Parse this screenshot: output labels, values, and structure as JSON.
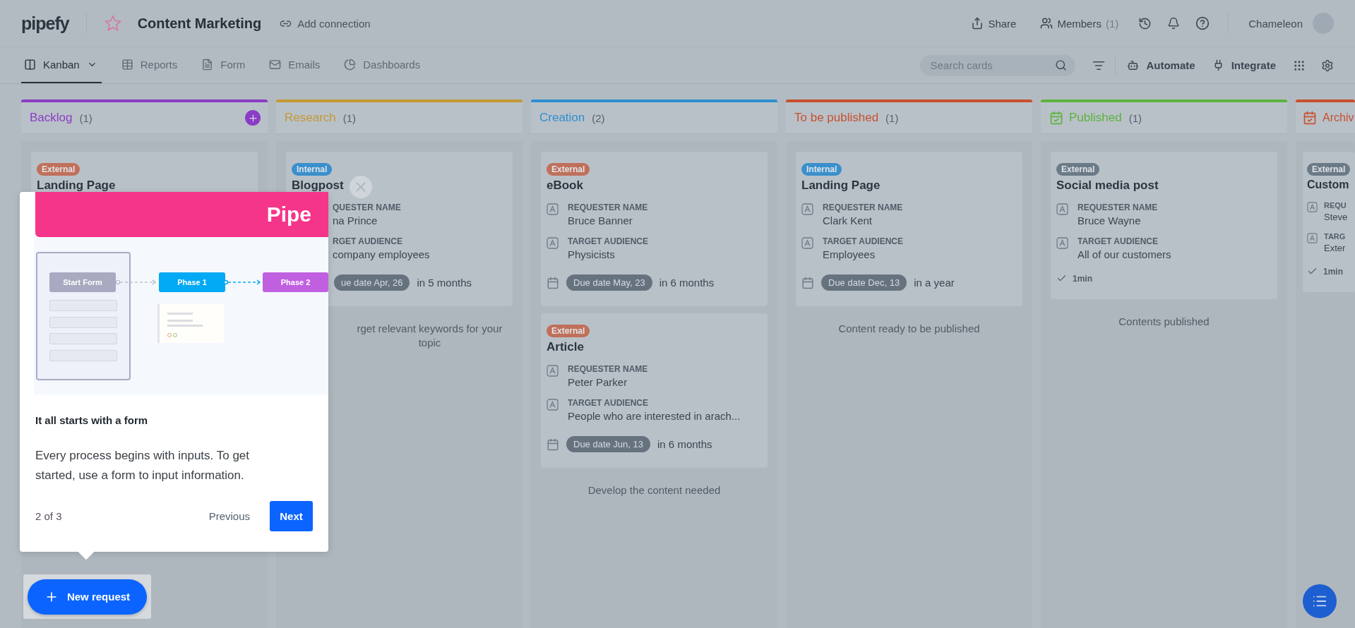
{
  "header": {
    "logo": "pipefy",
    "title": "Content Marketing",
    "add_connection": "Add connection",
    "share": "Share",
    "members": {
      "label": "Members",
      "count": "(1)"
    },
    "user": "Chameleon"
  },
  "nav": {
    "tabs": [
      {
        "label": "Kanban",
        "kind": "kanban",
        "selected": true
      },
      {
        "label": "Reports",
        "kind": "reports",
        "selected": false
      },
      {
        "label": "Form",
        "kind": "form",
        "selected": false
      },
      {
        "label": "Emails",
        "kind": "emails",
        "selected": false
      },
      {
        "label": "Dashboards",
        "kind": "dashboards",
        "selected": false
      }
    ],
    "search": {
      "placeholder": "Search cards"
    },
    "tools": [
      {
        "label": "Automate",
        "kind": "robot"
      },
      {
        "label": "Integrate",
        "kind": "plug"
      }
    ]
  },
  "columns": [
    {
      "title": "Backlog",
      "count": "(1)",
      "color": "#8a3dc4",
      "kind": "open",
      "add_button": true,
      "cards": [
        {
          "tag": {
            "label": "External",
            "color": "#c0705a"
          },
          "title": "Landing Page",
          "covered": true
        }
      ]
    },
    {
      "title": "Research",
      "count": "(1)",
      "color": "#c39a34",
      "kind": "open",
      "add_button": false,
      "cards": [
        {
          "tag": {
            "label": "Internal",
            "color": "#3a8fcc"
          },
          "title": "Blogpost",
          "covered": true,
          "fields": [
            {
              "label": "QUESTER NAME",
              "value": "na Prince"
            },
            {
              "label": "RGET AUDIENCE",
              "value": "company employees"
            }
          ],
          "due": {
            "label": "ue date Apr, 26",
            "relative": "in 5 months"
          }
        }
      ],
      "footer": [
        "rget relevant keywords for your",
        "topic"
      ],
      "footer_covered": true
    },
    {
      "title": "Creation",
      "count": "(2)",
      "color": "#2d8fd0",
      "kind": "open",
      "add_button": false,
      "cards": [
        {
          "tag": {
            "label": "External",
            "color": "#c0705a"
          },
          "title": "eBook",
          "covered": false,
          "fields": [
            {
              "label": "REQUESTER NAME",
              "value": "Bruce Banner"
            },
            {
              "label": "TARGET AUDIENCE",
              "value": "Physicists"
            }
          ],
          "due": {
            "label": "Due date May, 23",
            "relative": "in 6 months"
          }
        },
        {
          "tag": {
            "label": "External",
            "color": "#c0705a"
          },
          "title": "Article",
          "covered": false,
          "fields": [
            {
              "label": "REQUESTER NAME",
              "value": "Peter Parker"
            },
            {
              "label": "TARGET AUDIENCE",
              "value": "People who are interested in arach..."
            }
          ],
          "due": {
            "label": "Due date Jun, 13",
            "relative": "in 6 months"
          }
        }
      ],
      "footer": [
        "Develop the content needed"
      ]
    },
    {
      "title": "To be published",
      "count": "(1)",
      "color": "#c7512f",
      "kind": "open",
      "add_button": false,
      "cards": [
        {
          "tag": {
            "label": "Internal",
            "color": "#3a8fcc"
          },
          "title": "Landing Page",
          "covered": false,
          "fields": [
            {
              "label": "REQUESTER NAME",
              "value": "Clark Kent"
            },
            {
              "label": "TARGET AUDIENCE",
              "value": "Employees"
            }
          ],
          "due": {
            "label": "Due date Dec, 13",
            "relative": "in a year"
          }
        }
      ],
      "footer": [
        "Content ready to be published"
      ]
    },
    {
      "title": "Published",
      "count": "(1)",
      "color": "#5cb43e",
      "kind": "done",
      "add_button": false,
      "cards": [
        {
          "tag": {
            "label": "External",
            "color": "#6b7a87"
          },
          "title": "Social media post",
          "covered": false,
          "fields": [
            {
              "label": "REQUESTER NAME",
              "value": "Bruce Wayne"
            },
            {
              "label": "TARGET AUDIENCE",
              "value": "All of our customers"
            }
          ],
          "completed": "1min"
        }
      ],
      "footer": [
        "Contents published"
      ]
    },
    {
      "title": "Archiv",
      "color": "#c7512f",
      "kind": "done",
      "add_button": false,
      "cut": true,
      "cards": [
        {
          "tag": {
            "label": "External",
            "color": "#6b7a87"
          },
          "title": "Custom",
          "covered": false,
          "fields": [
            {
              "label": "REQU",
              "value": "Steve"
            },
            {
              "label": "TARG",
              "value": "Exter"
            }
          ],
          "completed": "1min"
        }
      ]
    }
  ],
  "tour": {
    "banner": "Pipe",
    "diagram": {
      "start": "Start Form",
      "phase_1": "Phase 1",
      "phase_2": "Phase 2"
    },
    "title": "It all starts with a form",
    "text": "Every process begins with inputs. To get started, use a form to input information.",
    "step": "2 of 3",
    "previous": "Previous",
    "next": "Next"
  },
  "new_request": "New request"
}
